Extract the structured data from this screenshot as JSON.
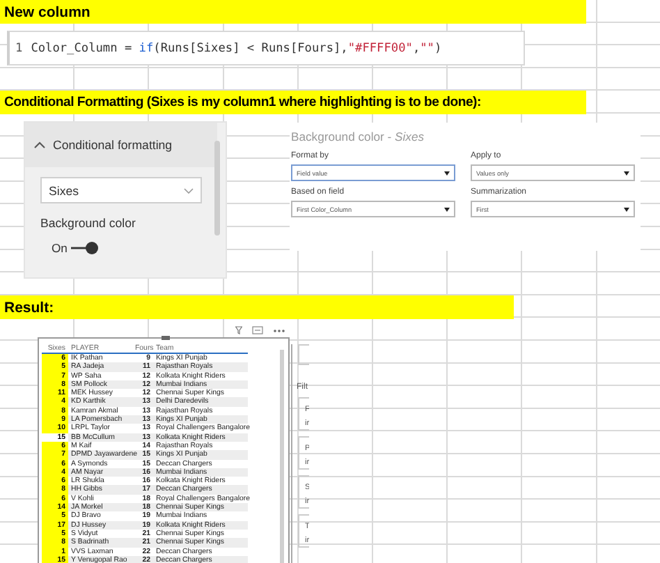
{
  "banners": [
    {
      "text": "New column"
    },
    {
      "text": "Conditional Formatting (Sixes is my column1 where highlighting is to be done):"
    },
    {
      "text": "Result:"
    }
  ],
  "code_bar": {
    "line_number": "1",
    "tokens": [
      {
        "text": "Color_Column = ",
        "kind": "plain"
      },
      {
        "text": "if",
        "kind": "keyword"
      },
      {
        "text": "(Runs[Sixes] < Runs[Fours],",
        "kind": "plain"
      },
      {
        "text": "\"#FFFF00\"",
        "kind": "string"
      },
      {
        "text": ",",
        "kind": "plain"
      },
      {
        "text": "\"\"",
        "kind": "string"
      },
      {
        "text": ")",
        "kind": "plain"
      }
    ]
  },
  "cf_panel": {
    "header": "Conditional formatting",
    "expanded": true,
    "field": "Sixes",
    "label": "Background color",
    "toggle": {
      "label": "On",
      "on": true
    }
  },
  "bg_dialog": {
    "title": "Background color - *Sixes*",
    "fields": [
      {
        "label": "Format by",
        "value": "Field value"
      },
      {
        "label": "Apply to",
        "value": "Values only"
      },
      {
        "label": "Based on field",
        "value": "First Color_Column"
      },
      {
        "label": "Summarization",
        "value": "First"
      }
    ]
  },
  "result_table": {
    "columns": [
      "Sixes",
      "PLAYER",
      "Fours",
      "Team"
    ],
    "rows": [
      {
        "sixes": "6",
        "player": "IK Pathan",
        "fours": "9",
        "team": "Kings XI Punjab",
        "highlighted": true
      },
      {
        "sixes": "5",
        "player": "RA Jadeja",
        "fours": "11",
        "team": "Rajasthan Royals",
        "highlighted": true
      },
      {
        "sixes": "7",
        "player": "WP Saha",
        "fours": "12",
        "team": "Kolkata Knight Riders",
        "highlighted": true
      },
      {
        "sixes": "8",
        "player": "SM Pollock",
        "fours": "12",
        "team": "Mumbai Indians",
        "highlighted": true
      },
      {
        "sixes": "11",
        "player": "MEK Hussey",
        "fours": "12",
        "team": "Chennai Super Kings",
        "highlighted": true
      },
      {
        "sixes": "4",
        "player": "KD Karthik",
        "fours": "13",
        "team": "Delhi Daredevils",
        "highlighted": true
      },
      {
        "sixes": "8",
        "player": "Kamran Akmal",
        "fours": "13",
        "team": "Rajasthan Royals",
        "highlighted": true
      },
      {
        "sixes": "9",
        "player": "LA Pomersbach",
        "fours": "13",
        "team": "Kings XI Punjab",
        "highlighted": true
      },
      {
        "sixes": "10",
        "player": "LRPL Taylor",
        "fours": "13",
        "team": "Royal Challengers Bangalore",
        "highlighted": true
      },
      {
        "sixes": "15",
        "player": "BB McCullum",
        "fours": "13",
        "team": "Kolkata Knight Riders",
        "highlighted": false
      },
      {
        "sixes": "6",
        "player": "M Kaif",
        "fours": "14",
        "team": "Rajasthan Royals",
        "highlighted": true
      },
      {
        "sixes": "7",
        "player": "DPMD Jayawardene",
        "fours": "15",
        "team": "Kings XI Punjab",
        "highlighted": true
      },
      {
        "sixes": "6",
        "player": "A Symonds",
        "fours": "15",
        "team": "Deccan Chargers",
        "highlighted": true
      },
      {
        "sixes": "4",
        "player": "AM Nayar",
        "fours": "16",
        "team": "Mumbai Indians",
        "highlighted": true
      },
      {
        "sixes": "6",
        "player": "LR Shukla",
        "fours": "16",
        "team": "Kolkata Knight Riders",
        "highlighted": true
      },
      {
        "sixes": "8",
        "player": "HH Gibbs",
        "fours": "17",
        "team": "Deccan Chargers",
        "highlighted": true
      },
      {
        "sixes": "6",
        "player": "V Kohli",
        "fours": "18",
        "team": "Royal Challengers Bangalore",
        "highlighted": true
      },
      {
        "sixes": "14",
        "player": "JA Morkel",
        "fours": "18",
        "team": "Chennai Super Kings",
        "highlighted": true
      },
      {
        "sixes": "5",
        "player": "DJ Bravo",
        "fours": "19",
        "team": "Mumbai Indians",
        "highlighted": true
      },
      {
        "sixes": "17",
        "player": "DJ Hussey",
        "fours": "19",
        "team": "Kolkata Knight Riders",
        "highlighted": true
      },
      {
        "sixes": "5",
        "player": "S Vidyut",
        "fours": "21",
        "team": "Chennai Super Kings",
        "highlighted": true
      },
      {
        "sixes": "8",
        "player": "S Badrinath",
        "fours": "21",
        "team": "Chennai Super Kings",
        "highlighted": true
      },
      {
        "sixes": "1",
        "player": "VVS Laxman",
        "fours": "22",
        "team": "Deccan Chargers",
        "highlighted": true
      },
      {
        "sixes": "15",
        "player": "Y Venugopal Rao",
        "fours": "22",
        "team": "Deccan Chargers",
        "highlighted": true
      }
    ]
  },
  "side_panel": {
    "heading": "Filt",
    "cards": [
      {
        "title": "F",
        "subtitle": "ir"
      },
      {
        "title": "P",
        "subtitle": "ir"
      },
      {
        "title": "S",
        "subtitle": "ir"
      },
      {
        "title": "T",
        "subtitle": "ir"
      }
    ]
  }
}
